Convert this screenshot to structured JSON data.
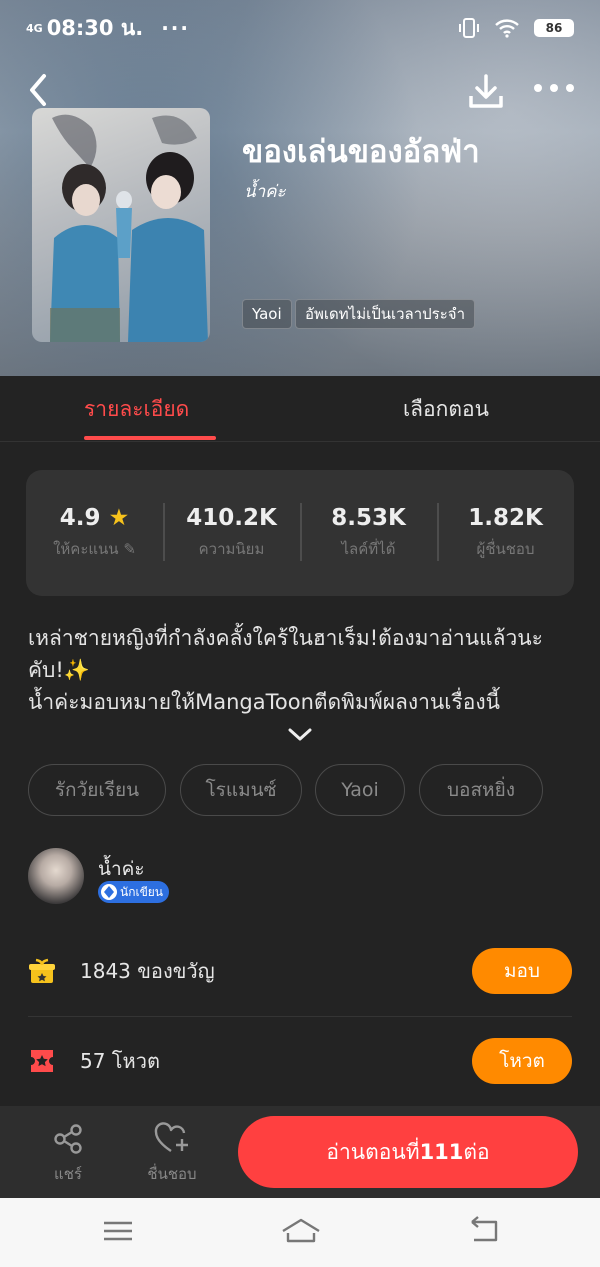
{
  "status_bar": {
    "signal": "4G",
    "time": "08:30 น.",
    "more": "···",
    "battery": "86"
  },
  "header": {
    "title": "ของเล่นของอัลฟ่า",
    "author": "น้ำค่ะ",
    "tags": [
      "Yaoi",
      "อัพเดทไม่เป็นเวลาประจำ"
    ]
  },
  "tabs": {
    "details": "รายละเอียด",
    "episodes": "เลือกตอน"
  },
  "stats": [
    {
      "value": "4.9",
      "label": "ให้คะแนน"
    },
    {
      "value": "410.2K",
      "label": "ความนิยม"
    },
    {
      "value": "8.53K",
      "label": "ไลค์ที่ได้"
    },
    {
      "value": "1.82K",
      "label": "ผู้ชื่นชอบ"
    }
  ],
  "description": {
    "line1": "เหล่าชายหญิงที่กำลังคลั้งใคร้ในฮาเร็ม!ต้องมาอ่านแล้วนะคับ!✨",
    "line2": "น้ำค่ะมอบหมายให้MangaToonตีดพิมพ์ผลงานเรื่องนี้"
  },
  "genres": [
    "รักวัยเรียน",
    "โรแมนซ์",
    "Yaoi",
    "บอสหยิ่ง"
  ],
  "author_section": {
    "name": "น้ำค่ะ",
    "badge": "นักเขียน"
  },
  "gifts": {
    "label": "1843 ของขวัญ",
    "button": "มอบ"
  },
  "votes": {
    "label": "57 โหวต",
    "button": "โหวต"
  },
  "bottom_bar": {
    "share": "แชร์",
    "favorite": "ชื่นชอบ",
    "read_prefix": "อ่านตอนที่",
    "read_number": "111",
    "read_suffix": "ต่อ"
  },
  "colors": {
    "accent": "#ff4b4b",
    "orange": "#ff8a00",
    "read_button": "#ff4040",
    "star": "#f6c21c"
  }
}
